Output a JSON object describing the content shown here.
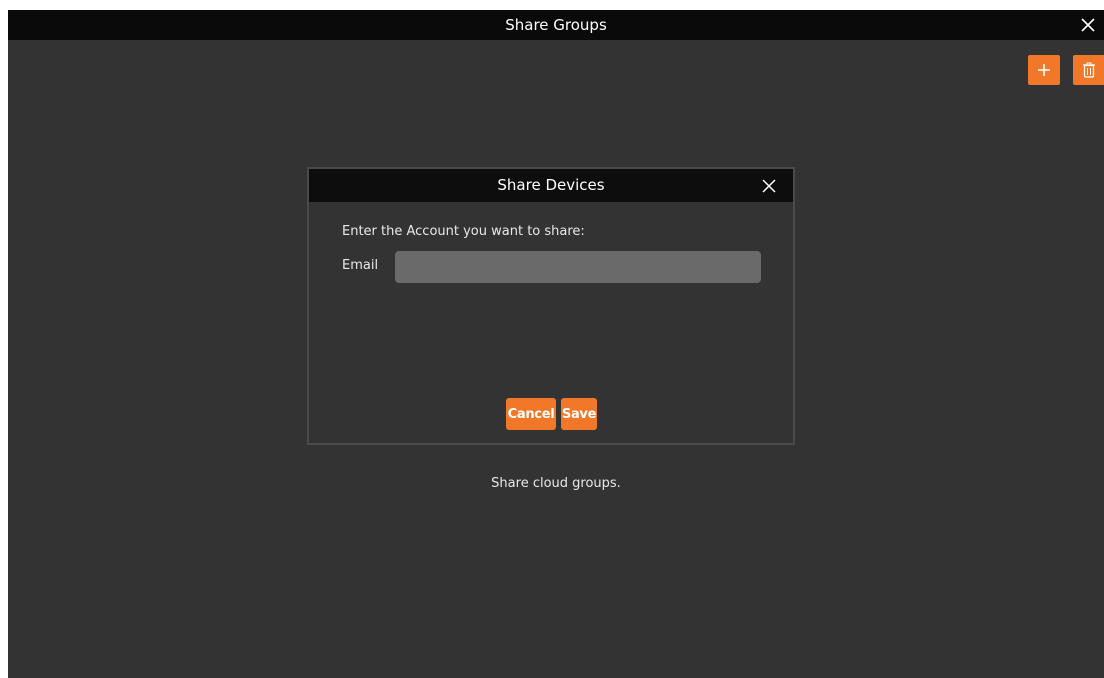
{
  "window": {
    "title": "Share Groups"
  },
  "toolbar": {
    "add_icon": "plus-icon",
    "delete_icon": "trash-icon",
    "accent_color": "#f07828"
  },
  "dialog": {
    "title": "Share Devices",
    "prompt": "Enter the Account you want to share:",
    "email_label": "Email",
    "email_value": "",
    "cancel_label": "Cancel",
    "save_label": "Save"
  },
  "footer": {
    "text": "Share cloud groups."
  }
}
